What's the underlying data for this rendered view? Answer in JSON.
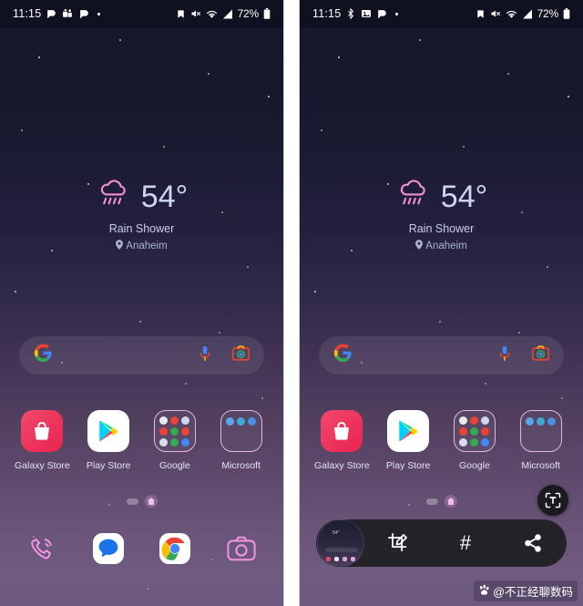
{
  "meta": {
    "panels": [
      "before-capture",
      "after-capture"
    ]
  },
  "status_bar": {
    "time": "11:15",
    "left_icons": [
      "app-notification-icon",
      "teams-notification-icon",
      "app-notification-icon-2",
      "more-notifications-dot"
    ],
    "right_icons": [
      "saved-icon",
      "mute-icon",
      "wifi-icon",
      "signal-icon"
    ],
    "battery_percent": "72%",
    "battery_icon": "battery-icon",
    "background": "#0f1120"
  },
  "status_bar_right_panel": {
    "time": "11:15",
    "left_icons": [
      "bluetooth-icon",
      "screenshot-saved-icon",
      "app-notification-icon",
      "more-notifications-dot"
    ],
    "right_icons": [
      "saved-icon",
      "mute-icon",
      "wifi-icon",
      "signal-icon"
    ],
    "battery_percent": "72%"
  },
  "weather": {
    "icon": "rain-shower-icon",
    "temperature": "54°",
    "condition": "Rain Shower",
    "location": "Anaheim",
    "location_icon": "location-pin-icon"
  },
  "search": {
    "logo": "google-g-icon",
    "placeholder": "",
    "value": "",
    "voice_icon": "microphone-icon",
    "lens_icon": "google-lens-icon"
  },
  "apps": [
    {
      "label": "Galaxy Store",
      "icon": "galaxy-store-icon",
      "type": "app",
      "color": "#ee3a5c"
    },
    {
      "label": "Play Store",
      "icon": "play-store-icon",
      "type": "app",
      "color": "#ffffff"
    },
    {
      "label": "Google",
      "icon": "google-folder-icon",
      "type": "folder",
      "rows": 3,
      "dots": [
        "#e8eaed",
        "#ea4335",
        "#4285f4",
        "#ea4335",
        "#34a853",
        "#ea4335",
        "#fbbc05",
        "#34a853",
        "#4285f4"
      ]
    },
    {
      "label": "Microsoft",
      "icon": "microsoft-folder-icon",
      "type": "folder",
      "rows": 1,
      "dots": [
        "#5aa6e8",
        "#3ea9d8",
        "#4a90e2"
      ]
    }
  ],
  "page_indicator": {
    "pill": "page-dot",
    "home": "home-page-icon"
  },
  "dock": [
    {
      "label": "Phone",
      "icon": "phone-icon",
      "style": "neon-outline",
      "color": "#f090e0"
    },
    {
      "label": "Messages",
      "icon": "messages-icon",
      "style": "filled",
      "color": "#2e7df6"
    },
    {
      "label": "Chrome",
      "icon": "chrome-icon",
      "style": "filled",
      "color": "#ffffff"
    },
    {
      "label": "Camera",
      "icon": "camera-icon",
      "style": "neon-outline",
      "color": "#f090e0"
    }
  ],
  "screenshot_toolbar": {
    "thumbnail": "screenshot-thumbnail",
    "buttons": [
      {
        "name": "crop-edit-button",
        "icon": "crop-pen-icon",
        "label": ""
      },
      {
        "name": "tags-button",
        "icon": "hashtag-icon",
        "label": "#"
      },
      {
        "name": "share-button",
        "icon": "share-icon",
        "label": ""
      }
    ],
    "background": "#1e1e22"
  },
  "ocr_button": {
    "name": "extract-text-button",
    "icon": "text-extract-icon",
    "label": "T"
  },
  "watermark": {
    "icon": "baidu-paw-icon",
    "text": "@不正经聊数码"
  },
  "colors": {
    "bg_top": "#14162a",
    "bg_bottom": "#6e5a80",
    "accent_pink": "#e3b6e0",
    "text_primary": "#e6e2f2"
  }
}
